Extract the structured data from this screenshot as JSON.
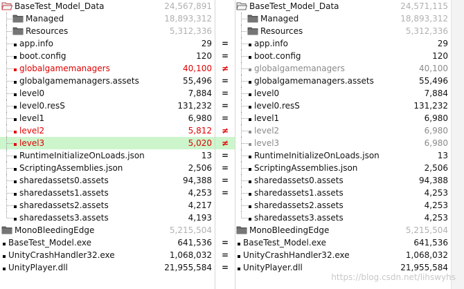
{
  "left": {
    "rows": [
      {
        "name": "BaseTest_Model_Data",
        "size": "24,567,891",
        "type": "root-open",
        "status": "normal"
      },
      {
        "name": "Managed",
        "size": "18,893,312",
        "type": "folder",
        "status": "normal"
      },
      {
        "name": "Resources",
        "size": "5,312,336",
        "type": "folder",
        "status": "normal"
      },
      {
        "name": "app.info",
        "size": "29",
        "type": "file",
        "status": "normal"
      },
      {
        "name": "boot.config",
        "size": "120",
        "type": "file",
        "status": "normal"
      },
      {
        "name": "globalgamemanagers",
        "size": "40,100",
        "type": "file",
        "status": "diff"
      },
      {
        "name": "globalgamemanagers.assets",
        "size": "55,496",
        "type": "file",
        "status": "normal"
      },
      {
        "name": "level0",
        "size": "7,884",
        "type": "file",
        "status": "normal"
      },
      {
        "name": "level0.resS",
        "size": "131,232",
        "type": "file",
        "status": "normal"
      },
      {
        "name": "level1",
        "size": "6,980",
        "type": "file",
        "status": "normal"
      },
      {
        "name": "level2",
        "size": "5,812",
        "type": "file",
        "status": "diff"
      },
      {
        "name": "level3",
        "size": "5,020",
        "type": "file",
        "status": "diff-selected"
      },
      {
        "name": "RuntimeInitializeOnLoads.json",
        "size": "13",
        "type": "file",
        "status": "normal"
      },
      {
        "name": "ScriptingAssemblies.json",
        "size": "2,506",
        "type": "file",
        "status": "normal"
      },
      {
        "name": "sharedassets0.assets",
        "size": "94,388",
        "type": "file",
        "status": "normal"
      },
      {
        "name": "sharedassets1.assets",
        "size": "4,253",
        "type": "file",
        "status": "normal"
      },
      {
        "name": "sharedassets2.assets",
        "size": "4,217",
        "type": "file",
        "status": "normal"
      },
      {
        "name": "sharedassets3.assets",
        "size": "4,193",
        "type": "file-last",
        "status": "normal"
      },
      {
        "name": "MonoBleedingEdge",
        "size": "5,215,504",
        "type": "root-folder",
        "status": "normal"
      },
      {
        "name": "BaseTest_Model.exe",
        "size": "641,536",
        "type": "root-file",
        "status": "normal"
      },
      {
        "name": "UnityCrashHandler32.exe",
        "size": "1,068,032",
        "type": "root-file",
        "status": "normal"
      },
      {
        "name": "UnityPlayer.dll",
        "size": "21,955,584",
        "type": "root-file",
        "status": "normal"
      }
    ]
  },
  "right": {
    "rows": [
      {
        "name": "BaseTest_Model_Data",
        "size": "24,571,115",
        "type": "root-open",
        "status": "normal"
      },
      {
        "name": "Managed",
        "size": "18,893,312",
        "type": "folder",
        "status": "normal"
      },
      {
        "name": "Resources",
        "size": "5,312,336",
        "type": "folder",
        "status": "normal"
      },
      {
        "name": "app.info",
        "size": "29",
        "type": "file",
        "status": "normal"
      },
      {
        "name": "boot.config",
        "size": "120",
        "type": "file",
        "status": "normal"
      },
      {
        "name": "globalgamemanagers",
        "size": "40,100",
        "type": "file",
        "status": "ghost"
      },
      {
        "name": "globalgamemanagers.assets",
        "size": "55,496",
        "type": "file",
        "status": "normal"
      },
      {
        "name": "level0",
        "size": "7,884",
        "type": "file",
        "status": "normal"
      },
      {
        "name": "level0.resS",
        "size": "131,232",
        "type": "file",
        "status": "normal"
      },
      {
        "name": "level1",
        "size": "6,980",
        "type": "file",
        "status": "normal"
      },
      {
        "name": "level2",
        "size": "6,980",
        "type": "file",
        "status": "ghost"
      },
      {
        "name": "level3",
        "size": "6,980",
        "type": "file",
        "status": "ghost"
      },
      {
        "name": "RuntimeInitializeOnLoads.json",
        "size": "13",
        "type": "file",
        "status": "normal"
      },
      {
        "name": "ScriptingAssemblies.json",
        "size": "2,506",
        "type": "file",
        "status": "normal"
      },
      {
        "name": "sharedassets0.assets",
        "size": "94,388",
        "type": "file",
        "status": "normal"
      },
      {
        "name": "sharedassets1.assets",
        "size": "4,253",
        "type": "file",
        "status": "normal"
      },
      {
        "name": "sharedassets2.assets",
        "size": "4,253",
        "type": "file",
        "status": "normal"
      },
      {
        "name": "sharedassets3.assets",
        "size": "4,253",
        "type": "file-last",
        "status": "normal"
      },
      {
        "name": "MonoBleedingEdge",
        "size": "5,215,504",
        "type": "root-folder",
        "status": "normal"
      },
      {
        "name": "BaseTest_Model.exe",
        "size": "641,536",
        "type": "root-file",
        "status": "normal"
      },
      {
        "name": "UnityCrashHandler32.exe",
        "size": "1,068,032",
        "type": "root-file",
        "status": "normal"
      },
      {
        "name": "UnityPlayer.dll",
        "size": "21,955,584",
        "type": "root-file",
        "status": "normal"
      }
    ]
  },
  "gutter": [
    "",
    "",
    "",
    "=",
    "=",
    "≠",
    "=",
    "=",
    "=",
    "=",
    "≠",
    "≠",
    "=",
    "=",
    "=",
    "=",
    "",
    "",
    "",
    "=",
    "=",
    "="
  ],
  "watermark": "https://blog.csdn.net/lihswyhs",
  "colors": {
    "diff": "#e00000",
    "ghost": "#8a8a8a",
    "selected_bg": "#ccf5cc",
    "folder_size": "#b0b0b0"
  },
  "icons": {
    "folder": "folder-icon",
    "open_folder": "open-folder-icon",
    "file": "file-bullet-icon"
  }
}
